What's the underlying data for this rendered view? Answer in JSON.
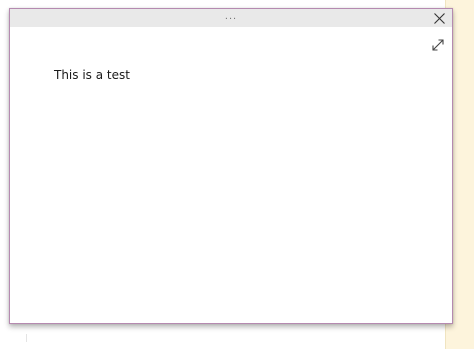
{
  "window": {
    "grip_icon": "more-horizontal-icon",
    "grip_label": "...",
    "close_icon": "close-icon",
    "expand_icon": "expand-icon"
  },
  "content": {
    "text": "This is a test"
  },
  "colors": {
    "border": "#b58ab0",
    "titlebar": "#e9e9e9",
    "side_strip": "#fdf4dc"
  }
}
